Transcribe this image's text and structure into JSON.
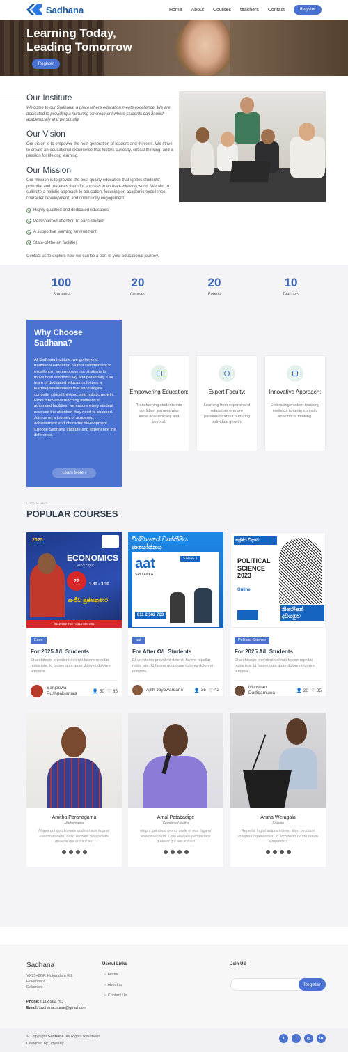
{
  "brand": {
    "name": "Sadhana"
  },
  "nav": {
    "items": [
      "Home",
      "About",
      "Courses",
      "teachers",
      "Contact"
    ],
    "register": "Register"
  },
  "hero": {
    "line1": "Learning Today,",
    "line2": "Leading Tomorrow",
    "button": "Register"
  },
  "institute": {
    "title": "Our Institute",
    "text": "Welcome to our Sadhana, a place where education meets excellence. We are dedicated to providing a nurturing environment where students can flourish academically and personally"
  },
  "vision": {
    "title": "Our Vision",
    "text": "Our vision is to empower the next generation of leaders and thinkers. We strive to create an educational experience that fosters curiosity, critical thinking, and a passion for lifelong learning."
  },
  "mission": {
    "title": "Our Mission",
    "text": "Our mission is to provide the best quality education that ignites students' potential and prepares them for success in an ever-evolving world. We aim to cultivate a holistic approach to education, focusing on academic excellence, character development, and community engagement."
  },
  "checks": [
    "Highly qualified and dedicated educators",
    "Personalized attention to each student",
    "A supportive learning environment",
    "State-of-the-art facilities"
  ],
  "contact_line": "Contact us to explore how we can be a part of your educational journey.",
  "stats": [
    {
      "num": "100",
      "label": "Students"
    },
    {
      "num": "20",
      "label": "Courses"
    },
    {
      "num": "20",
      "label": "Events"
    },
    {
      "num": "10",
      "label": "Teachers"
    }
  ],
  "why": {
    "title": "Why Choose Sadhana?",
    "text": "At Sadhana Institute, we go beyond traditional education. With a commitment to excellence, we empower our students to thrive both academically and personally. Our team of dedicated educators fosters a learning environment that encourages curiosity, critical thinking, and holistic growth. From innovative teaching methods to advanced facilities, we ensure every student receives the attention they need to succeed. Join us on a journey of academic achievement and character development. Choose Sadhana Institute and experience the difference.",
    "button": "Learn More"
  },
  "features": [
    {
      "title": "Empowering Education:",
      "desc": "Transforming students into confident learners who excel academically and beyond."
    },
    {
      "title": "Expert Faculty:",
      "desc": "Learning from experienced educators who are passionate about nurturing individual growth."
    },
    {
      "title": "Innovative Approach:",
      "desc": "Embracing modern teaching methods to ignite curiosity and critical thinking."
    }
  ],
  "courses_section": {
    "kicker": "COURSES",
    "title": "POPULAR COURSES"
  },
  "courses": [
    {
      "tag": "Econ",
      "title": "For 2025 A/L Students",
      "desc": "Et architecto provident deleniti facere repellat nobis iste. Id facere quia quae dolores dolorem tempore.",
      "teacher": "Sanjeewa Pushpakumara",
      "students": "50",
      "likes": "65",
      "poster": {
        "main": "ECONOMICS",
        "sub": "සාර්ථ විද්‍යාව",
        "name": "සංජීව පුෂ්පකුමාර",
        "phone": "0112 562 763 | 0114 380 281",
        "year": "2025",
        "date": "22",
        "time": "1.30 - 3.30"
      }
    },
    {
      "tag": "aat",
      "title": "For After O/L Students",
      "desc": "Et architecto provident deleniti facere repellat nobis iste. Id facere quia quae dolores dolorem tempore.",
      "teacher": "Ajith Jayawardane",
      "students": "35",
      "likes": "42",
      "poster": {
        "main": "විශ්වාසයේ වෘත්තීමය ආයෝජනය",
        "brand": "aat",
        "country": "SRI LANKA",
        "stage": "STAGE 1",
        "phone": "011 2 562 763"
      }
    },
    {
      "tag": "Political Science",
      "title": "For 2025 A/L Students",
      "desc": "Et architecto provident deleniti facere repellat nobis iste. Id facere quia quae dolores dolorem tempore.",
      "teacher": "Niroshan Dadigamuwa",
      "students": "20",
      "likes": "85",
      "poster": {
        "top": "ශ්‍රේෂ්ඨ විද්‍යාව",
        "main": "POLITICAL SCIENCE 2023",
        "name": "නිරෝෂන් දඩිගමුව",
        "online": "Online"
      }
    }
  ],
  "teachers": [
    {
      "name": "Amitha Paranagama",
      "role": "Mathematics",
      "desc": "Magni qui quod omnis unde et eos fuga et exercitationem. Odio veritatis perspiciatis quaerat qui aut aut aut"
    },
    {
      "name": "Amal Patabadige",
      "role": "Combined Maths",
      "desc": "Magni qui quod omnis unde et eos fuga et exercitationem. Odio veritatis perspiciatis quaerat qui aut aut aut"
    },
    {
      "name": "Aruna Weragala",
      "role": "Sinhala",
      "desc": "Repellat fugiat adipisci nemo illum nesciunt voluptas repellendus. In architecto rerum rerum temporibus"
    }
  ],
  "footer": {
    "brand": "Sadhana",
    "address": [
      "VX25+8GF, Hokandara Rd,",
      "Hokandara",
      "Colombo"
    ],
    "phone_label": "Phone:",
    "phone": "0112 562 763",
    "email_label": "Email:",
    "email": "sadhanacourse@gmail.com",
    "links_title": "Useful Links",
    "links": [
      "Home",
      "About us",
      "Contact Us"
    ],
    "join_title": "Join US",
    "join_button": "Register",
    "copyright_pre": "© Copyright ",
    "copyright_brand": "Sadhana",
    "copyright_post": ". All Rights Reserved",
    "designed": "Designed by Odyssey"
  },
  "colors": {
    "accent": "#4a72d1",
    "brand": "#1f5fa6"
  }
}
